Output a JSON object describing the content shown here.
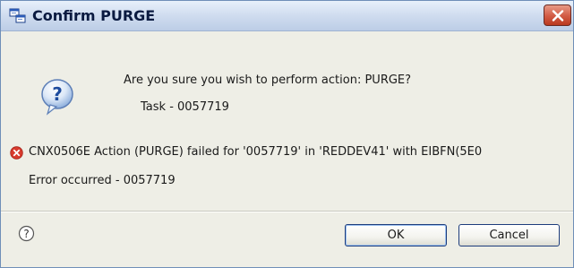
{
  "window": {
    "title": "Confirm PURGE"
  },
  "dialog": {
    "prompt": "Are you sure you wish to perform action: PURGE?",
    "task": "Task - 0057719",
    "error_message": "CNX0506E Action (PURGE) failed for '0057719' in 'REDDEV41' with EIBFN(5E0",
    "error_occurred": "Error occurred - 0057719"
  },
  "buttons": {
    "ok": "OK",
    "cancel": "Cancel"
  },
  "icons": {
    "app": "window-app-icon",
    "close": "close-icon",
    "question": "question-icon",
    "error": "error-icon",
    "help": "help-icon"
  },
  "colors": {
    "close_button": "#d25a44",
    "error_icon": "#d83b2e",
    "question_icon": "#2f5fb4",
    "titlebar": "#cfdcef"
  }
}
